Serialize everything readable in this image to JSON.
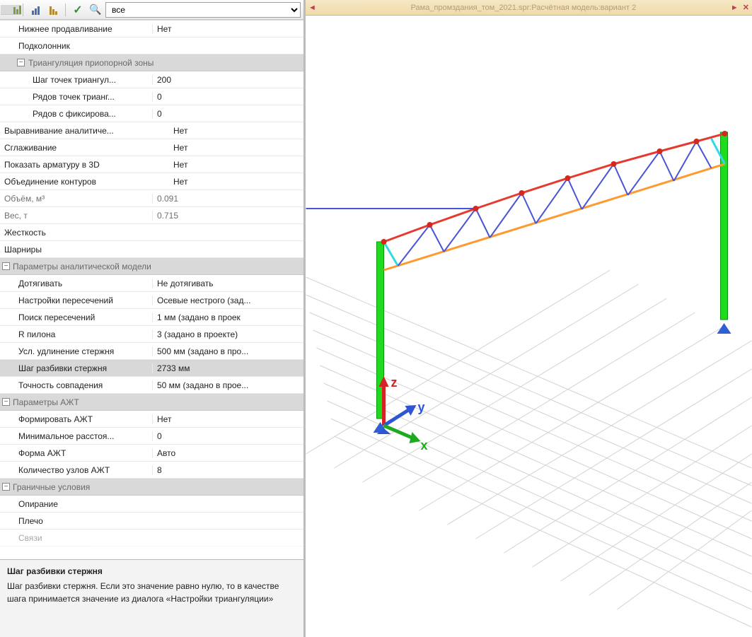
{
  "toolbar": {
    "filter_selected": "все"
  },
  "properties": {
    "r1": {
      "label": "Нижнее продавливание",
      "val": "Нет"
    },
    "r2": {
      "label": "Подколонник",
      "val": ""
    },
    "cat_triang": "Триангуляция приопорной зоны",
    "r3": {
      "label": "Шаг точек триангул...",
      "val": "200"
    },
    "r4": {
      "label": "Рядов точек трианг...",
      "val": "0"
    },
    "r5": {
      "label": "Рядов с фиксирова...",
      "val": "0"
    },
    "r6": {
      "label": "Выравнивание аналитиче...",
      "val": "Нет"
    },
    "r7": {
      "label": "Сглаживание",
      "val": "Нет"
    },
    "r8": {
      "label": "Показать арматуру в 3D",
      "val": "Нет"
    },
    "r9": {
      "label": "Объединение контуров",
      "val": "Нет"
    },
    "r10": {
      "label": "Объём, м³",
      "val": "0.091"
    },
    "r11": {
      "label": "Вес, т",
      "val": "0.715"
    },
    "r12": {
      "label": "Жесткость",
      "val": ""
    },
    "r13": {
      "label": "Шарниры",
      "val": ""
    },
    "cat_analyt": "Параметры аналитической модели",
    "r14": {
      "label": "Дотягивать",
      "val": "Не дотягивать"
    },
    "r15": {
      "label": "Настройки пересечений",
      "val": "Осевые нестрого  (зад..."
    },
    "r16": {
      "label": "Поиск пересечений",
      "val": "1 мм  (задано в проек"
    },
    "r17": {
      "label": "R пилона",
      "val": "3  (задано в проекте)"
    },
    "r18": {
      "label": "Усл. удлинение стержня",
      "val": "500 мм  (задано в про..."
    },
    "r19": {
      "label": "Шаг разбивки стержня",
      "val": "2733 мм"
    },
    "r20": {
      "label": "Точность совпадения",
      "val": "50 мм  (задано в прое..."
    },
    "cat_azht": "Параметры АЖТ",
    "r21": {
      "label": "Формировать АЖТ",
      "val": "Нет"
    },
    "r22": {
      "label": "Минимальное расстоя...",
      "val": "0"
    },
    "r23": {
      "label": "Форма АЖТ",
      "val": "Авто"
    },
    "r24": {
      "label": "Количество узлов АЖТ",
      "val": "8"
    },
    "cat_bc": "Граничные условия",
    "r25": {
      "label": "Опирание",
      "val": ""
    },
    "r26": {
      "label": "Плечо",
      "val": ""
    },
    "r27": {
      "label": "Связи",
      "val": ""
    }
  },
  "help": {
    "title": "Шаг разбивки стержня",
    "body": "Шаг разбивки стержня. Если это значение равно нулю, то в качестве шага принимается значение из диалога «Настройки триангуляции»"
  },
  "viewport": {
    "tab_title": "Рама_промздания_том_2021.spr:Расчётная модель:вариант 2",
    "axes": {
      "x": "x",
      "y": "y",
      "z": "z"
    }
  }
}
